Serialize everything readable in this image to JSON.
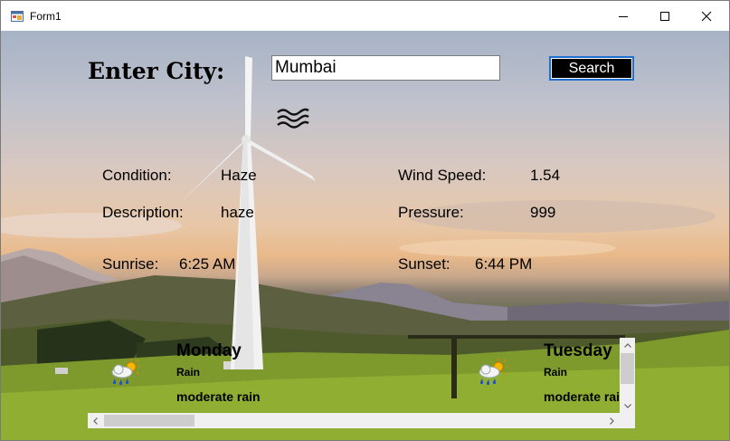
{
  "window": {
    "title": "Form1"
  },
  "search": {
    "label": "Enter City:",
    "value": "Mumbai",
    "button": "Search"
  },
  "current": {
    "icon": "haze-icon",
    "condition_label": "Condition:",
    "condition_value": "Haze",
    "description_label": "Description:",
    "description_value": "haze",
    "sunrise_label": "Sunrise:",
    "sunrise_value": "6:25 AM",
    "wind_label": "Wind Speed:",
    "wind_value": "1.54",
    "pressure_label": "Pressure:",
    "pressure_value": "999",
    "sunset_label": "Sunset:",
    "sunset_value": "6:44 PM"
  },
  "forecast": [
    {
      "day": "Monday",
      "main": "Rain",
      "description": "moderate rain",
      "icon": "sun-rain-cloud-icon"
    },
    {
      "day": "Tuesday",
      "main": "Rain",
      "description": "moderate rain",
      "icon": "sun-rain-cloud-icon"
    }
  ],
  "colors": {
    "search_button_bg": "#000000",
    "search_button_border": "#1e6fd0",
    "text": "#000000"
  }
}
